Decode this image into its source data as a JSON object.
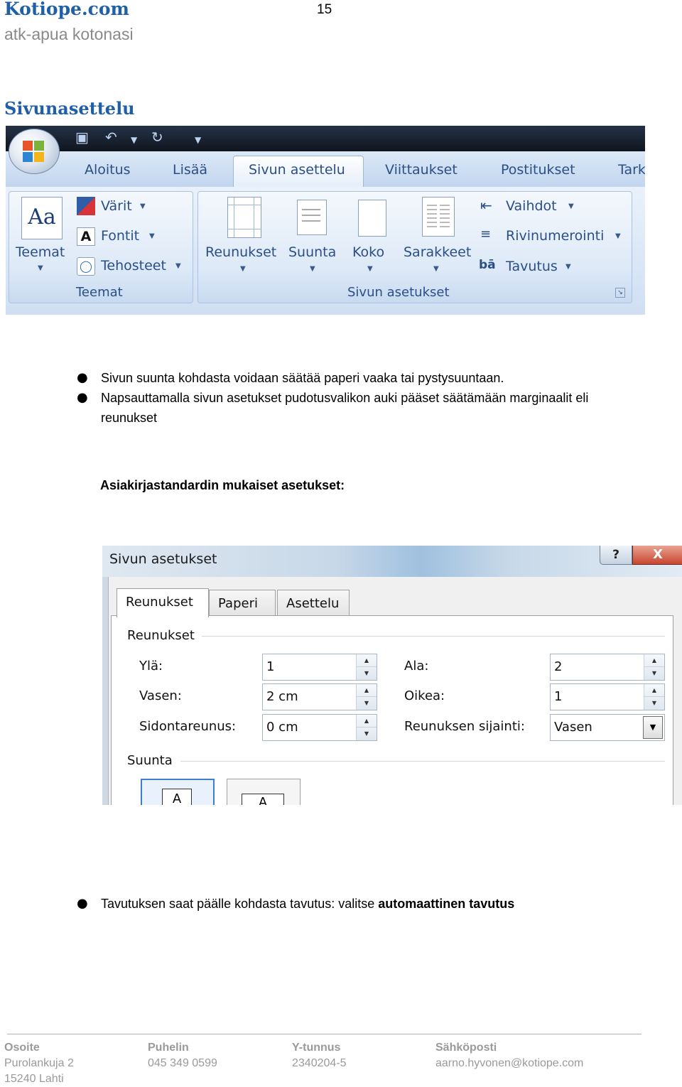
{
  "header": {
    "site_name": "Kotiope.com",
    "tagline": "atk-apua kotonasi",
    "page_number": "15"
  },
  "section_title": "Sivunasettelu",
  "ribbon": {
    "tabs": [
      "Aloitus",
      "Lisää",
      "Sivun asettelu",
      "Viittaukset",
      "Postitukset",
      "Tark"
    ],
    "active_tab": "Sivun asettelu",
    "themes_group": {
      "label": "Teemat",
      "big_button": "Teemat",
      "items": [
        "Värit",
        "Fontit",
        "Tehosteet"
      ]
    },
    "page_setup_group": {
      "label": "Sivun asetukset",
      "buttons": [
        "Reunukset",
        "Suunta",
        "Koko",
        "Sarakkeet"
      ],
      "items": [
        "Vaihdot",
        "Rivinumerointi",
        "Tavutus"
      ]
    },
    "colors": {
      "tab_text": "#2a4f86",
      "qat_bg": "#1a2231"
    }
  },
  "bullets": [
    "Sivun suunta kohdasta voidaan säätää paperi vaaka tai pystysuuntaan.",
    "Napsauttamalla sivun asetukset pudotusvalikon auki pääset säätämään marginaalit eli",
    "reunukset"
  ],
  "subheading": "Asiakirjastandardin mukaiset asetukset:",
  "dialog": {
    "title": "Sivun asetukset",
    "help": "?",
    "close": "X",
    "tabs": [
      "Reunukset",
      "Paperi",
      "Asettelu"
    ],
    "active_tab": "Reunukset",
    "margins_section": "Reunukset",
    "fields": {
      "top": {
        "label": "Ylä:",
        "value": "1"
      },
      "left": {
        "label": "Vasen:",
        "value": "2 cm"
      },
      "gutter": {
        "label": "Sidontareunus:",
        "value": "0 cm"
      },
      "bottom": {
        "label": "Ala:",
        "value": "2"
      },
      "right": {
        "label": "Oikea:",
        "value": "1"
      },
      "gutter_pos": {
        "label": "Reunuksen sijainti:",
        "value": "Vasen"
      }
    },
    "orientation_section": "Suunta"
  },
  "last_bullet": {
    "text": "Tavutuksen saat päälle kohdasta tavutus: valitse ",
    "bold": "automaattinen tavutus"
  },
  "footer": {
    "address": {
      "head": "Osoite",
      "line1": "Purolankuja 2",
      "line2": "15240 Lahti"
    },
    "phone": {
      "head": "Puhelin",
      "line1": "045 349 0599"
    },
    "business_id": {
      "head": "Y-tunnus",
      "line1": "2340204-5"
    },
    "email": {
      "head": "Sähköposti",
      "line1": "aarno.hyvonen@kotiope.com"
    }
  }
}
